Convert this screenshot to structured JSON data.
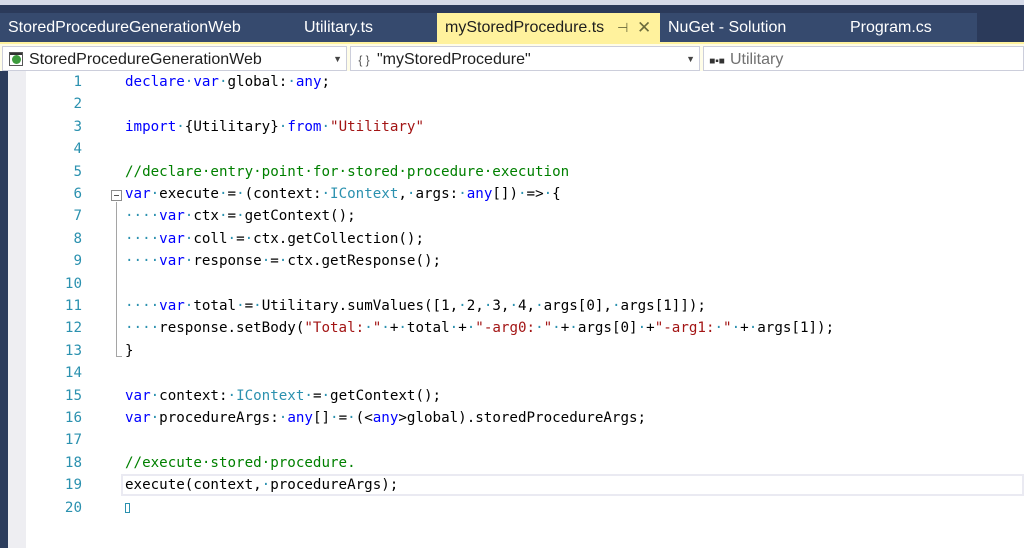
{
  "tabs": [
    {
      "label": "StoredProcedureGenerationWeb",
      "active": false
    },
    {
      "label": "Utilitary.ts",
      "active": false
    },
    {
      "label": "myStoredProcedure.ts",
      "active": true,
      "pin_icon": "pin-icon",
      "close_icon": "close-icon"
    },
    {
      "label": "NuGet - Solution",
      "active": false
    },
    {
      "label": "Program.cs",
      "active": false
    }
  ],
  "navbar": {
    "project": "StoredProcedureGenerationWeb",
    "scope": "\"myStoredProcedure\"",
    "member": "Utilitary",
    "project_icon": "web-project-icon",
    "scope_icon": "namespace-braces-icon",
    "member_icon": "module-icon"
  },
  "colors": {
    "keyword": "#0000ff",
    "type": "#2b91af",
    "string": "#a31515",
    "comment": "#008000",
    "line_number": "#2b91af",
    "active_tab": "#fff29d",
    "tab_bar": "#2b3a5a"
  },
  "editor": {
    "current_line": 19,
    "lines": [
      {
        "n": "1",
        "tokens": [
          [
            "kw",
            "declare"
          ],
          [
            "ws",
            "·"
          ],
          [
            "kw",
            "var"
          ],
          [
            "ws",
            "·"
          ],
          [
            "",
            "global:"
          ],
          [
            "ws",
            "·"
          ],
          [
            "kw",
            "any"
          ],
          [
            "",
            ";"
          ]
        ]
      },
      {
        "n": "2",
        "tokens": []
      },
      {
        "n": "3",
        "tokens": [
          [
            "kw",
            "import"
          ],
          [
            "ws",
            "·"
          ],
          [
            "",
            "{Utilitary}"
          ],
          [
            "ws",
            "·"
          ],
          [
            "kw",
            "from"
          ],
          [
            "ws",
            "·"
          ],
          [
            "str",
            "\"Utilitary\""
          ]
        ]
      },
      {
        "n": "4",
        "tokens": []
      },
      {
        "n": "5",
        "tokens": [
          [
            "cm",
            "//declare·entry·point·for·stored·procedure·execution"
          ]
        ]
      },
      {
        "n": "6",
        "tokens": [
          [
            "kw",
            "var"
          ],
          [
            "ws",
            "·"
          ],
          [
            "",
            "execute"
          ],
          [
            "ws",
            "·"
          ],
          [
            "",
            "="
          ],
          [
            "ws",
            "·"
          ],
          [
            "",
            "(context:"
          ],
          [
            "ws",
            "·"
          ],
          [
            "ty",
            "IContext"
          ],
          [
            "",
            ","
          ],
          [
            "ws",
            "·"
          ],
          [
            "",
            "args:"
          ],
          [
            "ws",
            "·"
          ],
          [
            "kw",
            "any"
          ],
          [
            "",
            "[])"
          ],
          [
            "ws",
            "·"
          ],
          [
            "",
            "=>"
          ],
          [
            "ws",
            "·"
          ],
          [
            "",
            "{"
          ]
        ]
      },
      {
        "n": "7",
        "tokens": [
          [
            "ws",
            "····"
          ],
          [
            "kw",
            "var"
          ],
          [
            "ws",
            "·"
          ],
          [
            "",
            "ctx"
          ],
          [
            "ws",
            "·"
          ],
          [
            "",
            "="
          ],
          [
            "ws",
            "·"
          ],
          [
            "",
            "getContext();"
          ]
        ]
      },
      {
        "n": "8",
        "tokens": [
          [
            "ws",
            "····"
          ],
          [
            "kw",
            "var"
          ],
          [
            "ws",
            "·"
          ],
          [
            "",
            "coll"
          ],
          [
            "ws",
            "·"
          ],
          [
            "",
            "="
          ],
          [
            "ws",
            "·"
          ],
          [
            "",
            "ctx.getCollection();"
          ]
        ]
      },
      {
        "n": "9",
        "tokens": [
          [
            "ws",
            "····"
          ],
          [
            "kw",
            "var"
          ],
          [
            "ws",
            "·"
          ],
          [
            "",
            "response"
          ],
          [
            "ws",
            "·"
          ],
          [
            "",
            "="
          ],
          [
            "ws",
            "·"
          ],
          [
            "",
            "ctx.getResponse();"
          ]
        ]
      },
      {
        "n": "10",
        "tokens": []
      },
      {
        "n": "11",
        "tokens": [
          [
            "ws",
            "····"
          ],
          [
            "kw",
            "var"
          ],
          [
            "ws",
            "·"
          ],
          [
            "",
            "total"
          ],
          [
            "ws",
            "·"
          ],
          [
            "",
            "="
          ],
          [
            "ws",
            "·"
          ],
          [
            "",
            "Utilitary.sumValues([1,"
          ],
          [
            "ws",
            "·"
          ],
          [
            "",
            "2,"
          ],
          [
            "ws",
            "·"
          ],
          [
            "",
            "3,"
          ],
          [
            "ws",
            "·"
          ],
          [
            "",
            "4,"
          ],
          [
            "ws",
            "·"
          ],
          [
            "",
            "args[0],"
          ],
          [
            "ws",
            "·"
          ],
          [
            "",
            "args[1]]);"
          ]
        ]
      },
      {
        "n": "12",
        "tokens": [
          [
            "ws",
            "····"
          ],
          [
            "",
            "response.setBody("
          ],
          [
            "str",
            "\"Total:"
          ],
          [
            "ws",
            "·"
          ],
          [
            "str",
            "\""
          ],
          [
            "ws",
            "·"
          ],
          [
            "",
            "+"
          ],
          [
            "ws",
            "·"
          ],
          [
            "",
            "total"
          ],
          [
            "ws",
            "·"
          ],
          [
            "",
            "+"
          ],
          [
            "ws",
            "·"
          ],
          [
            "str",
            "\"-arg0:"
          ],
          [
            "ws",
            "·"
          ],
          [
            "str",
            "\""
          ],
          [
            "ws",
            "·"
          ],
          [
            "",
            "+"
          ],
          [
            "ws",
            "·"
          ],
          [
            "",
            "args[0]"
          ],
          [
            "ws",
            "·"
          ],
          [
            "",
            "+"
          ],
          [
            "str",
            "\"-arg1:"
          ],
          [
            "ws",
            "·"
          ],
          [
            "str",
            "\""
          ],
          [
            "ws",
            "·"
          ],
          [
            "",
            "+"
          ],
          [
            "ws",
            "·"
          ],
          [
            "",
            "args[1]);"
          ]
        ]
      },
      {
        "n": "13",
        "tokens": [
          [
            "",
            "}"
          ]
        ]
      },
      {
        "n": "14",
        "tokens": []
      },
      {
        "n": "15",
        "tokens": [
          [
            "kw",
            "var"
          ],
          [
            "ws",
            "·"
          ],
          [
            "",
            "context:"
          ],
          [
            "ws",
            "·"
          ],
          [
            "ty",
            "IContext"
          ],
          [
            "ws",
            "·"
          ],
          [
            "",
            "="
          ],
          [
            "ws",
            "·"
          ],
          [
            "",
            "getContext();"
          ]
        ]
      },
      {
        "n": "16",
        "tokens": [
          [
            "kw",
            "var"
          ],
          [
            "ws",
            "·"
          ],
          [
            "",
            "procedureArgs:"
          ],
          [
            "ws",
            "·"
          ],
          [
            "kw",
            "any"
          ],
          [
            "",
            "[]"
          ],
          [
            "ws",
            "·"
          ],
          [
            "",
            "="
          ],
          [
            "ws",
            "·"
          ],
          [
            "",
            "(<"
          ],
          [
            "kw",
            "any"
          ],
          [
            "",
            ">global).storedProcedureArgs;"
          ]
        ]
      },
      {
        "n": "17",
        "tokens": []
      },
      {
        "n": "18",
        "tokens": [
          [
            "cm",
            "//execute·stored·procedure."
          ]
        ]
      },
      {
        "n": "19",
        "tokens": [
          [
            "",
            "execute(context,"
          ],
          [
            "ws",
            "·"
          ],
          [
            "",
            "procedureArgs);"
          ]
        ]
      },
      {
        "n": "20",
        "tokens": [
          [
            "caret",
            "end-of-file-marker"
          ]
        ]
      }
    ]
  }
}
